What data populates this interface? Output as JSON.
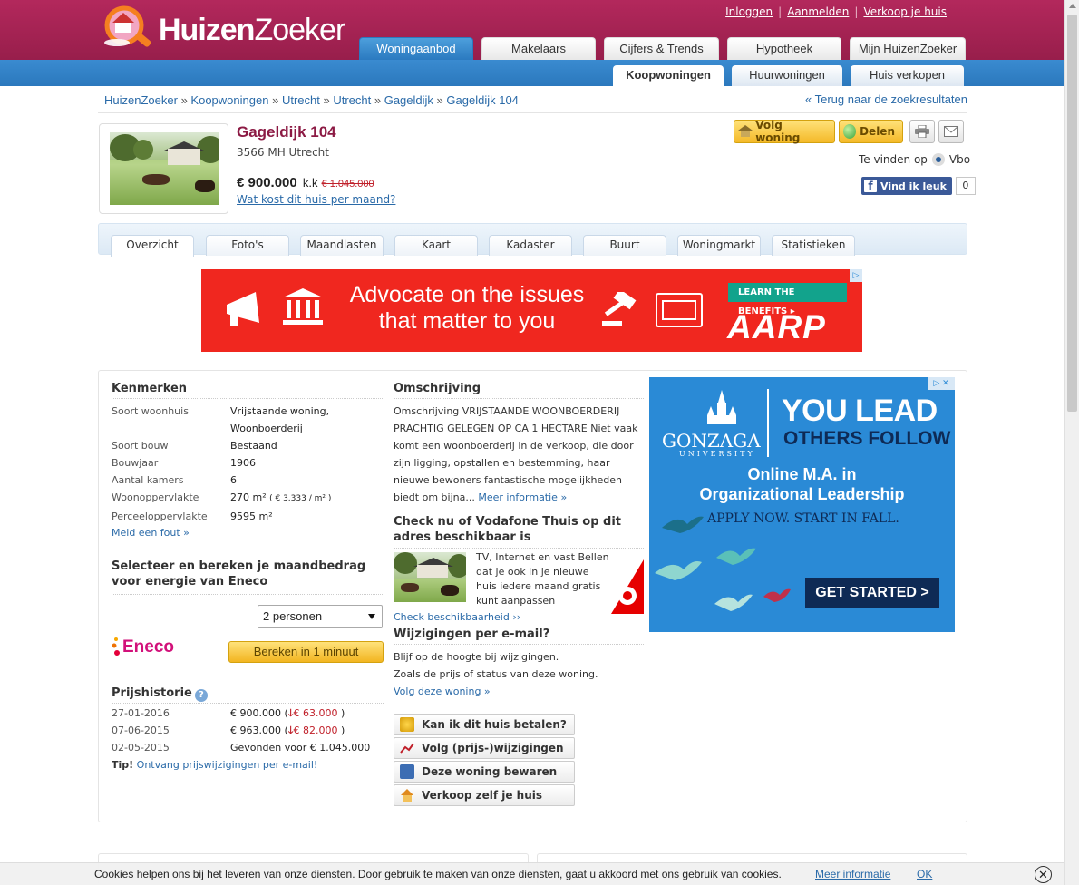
{
  "brand": {
    "name_bold": "Huizen",
    "name_light": "Zoeker"
  },
  "toplinks": {
    "login": "Inloggen",
    "register": "Aanmelden",
    "sell": "Verkoop je huis"
  },
  "main_tabs": [
    {
      "label": "Woningaanbod",
      "active": true
    },
    {
      "label": "Makelaars"
    },
    {
      "label": "Cijfers & Trends"
    },
    {
      "label": "Hypotheek"
    },
    {
      "label": "Mijn HuizenZoeker"
    }
  ],
  "sub_tabs": [
    {
      "label": "Koopwoningen",
      "active": true
    },
    {
      "label": "Huurwoningen"
    },
    {
      "label": "Huis verkopen"
    }
  ],
  "breadcrumb": [
    "HuizenZoeker",
    "Koopwoningen",
    "Utrecht",
    "Utrecht",
    "Gageldijk",
    "Gageldijk 104"
  ],
  "breadcrumb_sep": "»",
  "back_link": "« Terug naar de zoekresultaten",
  "listing": {
    "title": "Gageldijk 104",
    "zip": "3566 MH Utrecht",
    "price": "€ 900.000",
    "price_suffix": "k.k",
    "old_price": "€ 1.045.000",
    "cost_link": "Wat kost dit huis per maand?"
  },
  "actions": {
    "follow": "Volg woning",
    "share": "Delen",
    "found_at": "Te vinden op",
    "found_site": "Vbo",
    "fb_like": "Vind ik leuk",
    "fb_count": "0"
  },
  "detail_tabs": [
    "Overzicht",
    "Foto's",
    "Maandlasten",
    "Kaart",
    "Kadaster",
    "Buurt",
    "Woningmarkt",
    "Statistieken"
  ],
  "ad1": {
    "line1": "Advocate on the issues",
    "line2": "that matter to you",
    "cta": "LEARN THE BENEFITS ▸",
    "brand": "AARP"
  },
  "kenmerken": {
    "title": "Kenmerken",
    "rows": [
      {
        "k": "Soort woonhuis",
        "v": "Vrijstaande woning,"
      },
      {
        "k": "",
        "v": "Woonboerderij"
      },
      {
        "k": "Soort bouw",
        "v": "Bestaand"
      },
      {
        "k": "Bouwjaar",
        "v": "1906"
      },
      {
        "k": "Aantal kamers",
        "v": "6"
      },
      {
        "k": "Woonoppervlakte",
        "v": "270 m²",
        "extra": "( € 3.333 / m² )"
      },
      {
        "k": "Perceeloppervlakte",
        "v": "9595 m²"
      }
    ],
    "report": "Meld een fout »"
  },
  "energy": {
    "title": "Selecteer en bereken je maandbedrag voor energie van Eneco",
    "select": "2 personen",
    "brand": "Eneco",
    "button": "Bereken in 1 minuut"
  },
  "prijshistorie": {
    "title": "Prijshistorie",
    "rows": [
      {
        "date": "27-01-2016",
        "price": "€ 900.000 (",
        "delta": "€ 63.000",
        "close": ")"
      },
      {
        "date": "07-06-2015",
        "price": "€ 963.000 (",
        "delta": "€ 82.000",
        "close": ")"
      },
      {
        "date": "02-05-2015",
        "price": "Gevonden voor € 1.045.000",
        "delta": "",
        "close": ""
      }
    ],
    "tip_label": "Tip!",
    "tip_link": "Ontvang prijswijzigingen per e-mail!"
  },
  "omschrijving": {
    "title": "Omschrijving",
    "text": "Omschrijving VRIJSTAANDE WOONBOERDERIJ PRACHTIG GELEGEN OP CA 1 HECTARE Niet vaak komt een woonboerderij in de verkoop, die door zijn ligging, opstallen en bestemming, haar nieuwe bewoners fantastische mogelijkheden biedt om bijna...",
    "more": "Meer informatie »"
  },
  "vodafone": {
    "title": "Check nu of Vodafone Thuis op dit adres beschikbaar is",
    "text": "TV, Internet en vast Bellen dat je ook in je nieuwe huis iedere maand gratis kunt aanpassen",
    "link": "Check beschikbaarheid ››"
  },
  "email_changes": {
    "title": "Wijzigingen per e-mail?",
    "line1": "Blijf op de hoogte bij wijzigingen.",
    "line2": "Zoals de prijs of status van deze woning.",
    "link": "Volg deze woning »"
  },
  "side_buttons": [
    "Kan ik dit huis betalen?",
    "Volg (prijs-)wijzigingen",
    "Deze woning bewaren",
    "Verkoop zelf je huis"
  ],
  "ad2": {
    "logo": "GONZAGA",
    "logo_sub": "UNIVERSITY",
    "lead": "YOU LEAD",
    "follow": "OTHERS FOLLOW",
    "ma1": "Online M.A. in",
    "ma2": "Organizational Leadership",
    "apply": "APPLY NOW. START IN FALL.",
    "cta": "GET STARTED >"
  },
  "cookie": {
    "message": "Cookies helpen ons bij het leveren van onze diensten. Door gebruik te maken van onze diensten, gaat u akkoord met ons gebruik van cookies.",
    "more": "Meer informatie",
    "ok": "OK",
    "close": "✕"
  },
  "colors": {
    "brand": "#9c1f4f",
    "blue": "#2b7ac0",
    "link": "#2a6aa8",
    "accent_red": "#c0202a",
    "aarp_red": "#f0271f",
    "gonzaga_blue": "#2a8ad6"
  }
}
